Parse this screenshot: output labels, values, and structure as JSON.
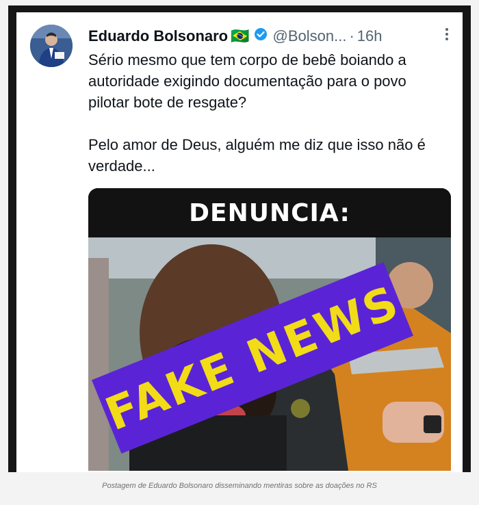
{
  "tweet": {
    "display_name": "Eduardo Bolsonaro",
    "flag": "🇧🇷",
    "verified_icon": "verified-badge-icon",
    "handle": "@Bolson...",
    "separator": "·",
    "time": "16h",
    "more_icon": "more-options-icon",
    "paragraphs": [
      "Sério mesmo que tem corpo de bebê boiando a autoridade exigindo documentação para o povo pilotar bote de resgate?",
      "Pelo amor de Deus, alguém me diz que isso não é verdade..."
    ],
    "media": {
      "banner": "DENUNCIA:",
      "stamp": "FAKE NEWS"
    }
  },
  "caption": "Postagem de Eduardo Bolsonaro disseminando mentiras sobre as doações no RS",
  "colors": {
    "verified": "#1d9bf0",
    "stamp_bg": "#5a24d6",
    "stamp_text": "#f2dc17"
  }
}
